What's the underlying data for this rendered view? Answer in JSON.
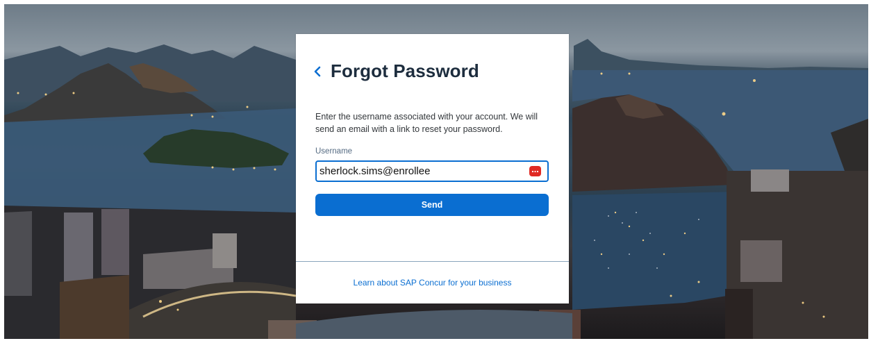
{
  "card": {
    "title": "Forgot Password",
    "description": "Enter the username associated with your account. We will send an email with a link to reset your password.",
    "username_label": "Username",
    "username_value": "sherlock.sims@enrollee",
    "send_label": "Send",
    "learn_link": "Learn about SAP Concur for your business"
  },
  "icons": {
    "back": "chevron-left-icon",
    "password_manager": "password-manager-icon"
  },
  "colors": {
    "accent": "#0a6ed1",
    "title": "#1d2d3e",
    "password_manager": "#e02a24"
  }
}
